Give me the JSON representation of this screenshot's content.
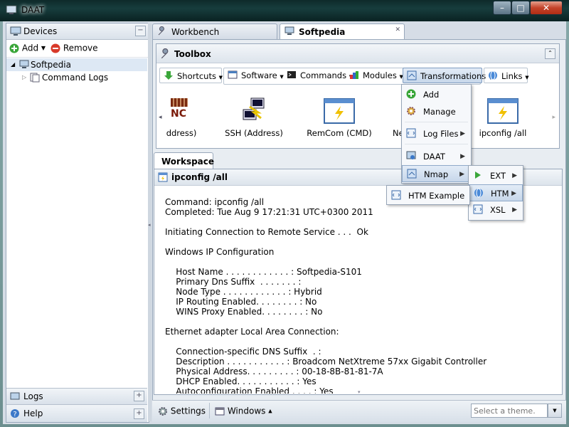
{
  "window": {
    "title": "DAAT",
    "min": "–",
    "max": "□",
    "close": "✕"
  },
  "left_panel": {
    "header": "Devices",
    "add_label": "Add",
    "remove_label": "Remove",
    "tree": [
      {
        "label": "Softpedia"
      },
      {
        "label": "Command Logs"
      }
    ],
    "logs_label": "Logs",
    "help_label": "Help"
  },
  "tabs": [
    {
      "label": "Workbench"
    },
    {
      "label": "Softpedia"
    }
  ],
  "toolbox": {
    "title": "Toolbox",
    "buttons": [
      {
        "label": "Shortcuts"
      },
      {
        "label": "Software"
      },
      {
        "label": "Commands"
      },
      {
        "label": "Modules"
      },
      {
        "label": "Transformations"
      },
      {
        "label": "Links"
      }
    ],
    "items": [
      {
        "label": "ddress)"
      },
      {
        "label": "SSH (Address)"
      },
      {
        "label": "RemCom (CMD)"
      },
      {
        "label": "Ne"
      },
      {
        "label": "ipconfig /all"
      }
    ]
  },
  "transform_menu": [
    {
      "label": "Add"
    },
    {
      "label": "Manage"
    },
    {
      "label": "Log Files"
    },
    {
      "label": "DAAT"
    },
    {
      "label": "Nmap"
    }
  ],
  "nmap_submenu": [
    {
      "label": "EXT"
    },
    {
      "label": "HTM"
    },
    {
      "label": "XSL"
    }
  ],
  "htm_submenu": [
    {
      "label": "HTM Example"
    }
  ],
  "workspace": {
    "tab_label": "Workspace",
    "doc_title": "ipconfig /all",
    "lines": [
      "Command: ipconfig /all",
      "Completed: Tue Aug 9 17:21:31 UTC+0300 2011",
      "",
      "Initiating Connection to Remote Service . . .  Ok",
      "",
      "Windows IP Configuration",
      "",
      "    Host Name . . . . . . . . . . . . : Softpedia-S101",
      "    Primary Dns Suffix  . . . . . . . :",
      "    Node Type . . . . . . . . . . . . : Hybrid",
      "    IP Routing Enabled. . . . . . . . : No",
      "    WINS Proxy Enabled. . . . . . . . : No",
      "",
      "Ethernet adapter Local Area Connection:",
      "",
      "    Connection-specific DNS Suffix  . :",
      "    Description . . . . . . . . . . . : Broadcom NetXtreme 57xx Gigabit Controller",
      "    Physical Address. . . . . . . . . : 00-18-8B-81-81-7A",
      "    DHCP Enabled. . . . . . . . . . . : Yes",
      "    Autoconfiguration Enabled . . . . : Yes"
    ]
  },
  "statusbar": {
    "settings_label": "Settings",
    "windows_label": "Windows",
    "theme_placeholder": "Select a theme..."
  }
}
